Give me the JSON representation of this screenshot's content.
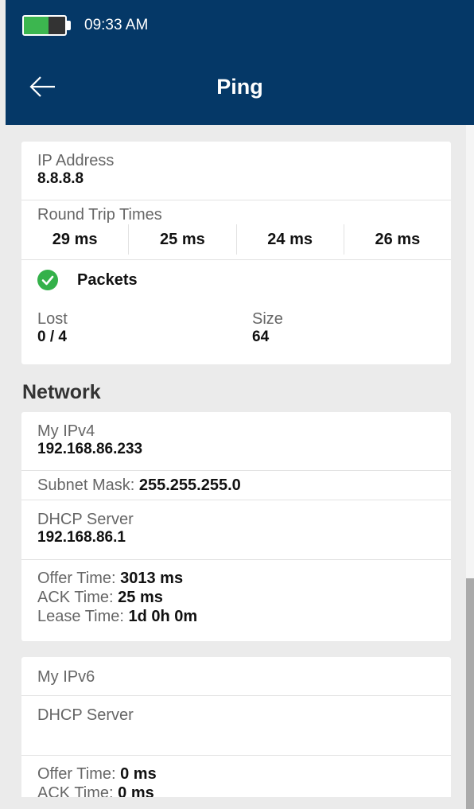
{
  "status_bar": {
    "time": "09:33 AM",
    "battery_level": 0.6,
    "battery_color": "#3cb64f"
  },
  "header": {
    "title": "Ping",
    "back_icon": "arrow-left-icon",
    "bg_color": "#053867"
  },
  "ping": {
    "ip_label": "IP Address",
    "ip_value": "8.8.8.8",
    "rtt_label": "Round Trip Times",
    "rtt": [
      "29 ms",
      "25 ms",
      "24 ms",
      "26 ms"
    ],
    "packets_label": "Packets",
    "status_icon": "check-circle-icon",
    "lost_label": "Lost",
    "lost_value": "0 / 4",
    "size_label": "Size",
    "size_value": "64"
  },
  "network": {
    "section_title": "Network",
    "ipv4": {
      "label": "My IPv4",
      "value": "192.168.86.233",
      "subnet_label": "Subnet Mask: ",
      "subnet_value": "255.255.255.0",
      "dhcp_label": "DHCP Server",
      "dhcp_value": "192.168.86.1",
      "offer_label": "Offer Time: ",
      "offer_value": "3013 ms",
      "ack_label": "ACK Time: ",
      "ack_value": "25 ms",
      "lease_label": "Lease Time: ",
      "lease_value": "1d 0h 0m"
    },
    "ipv6": {
      "label": "My IPv6",
      "dhcp_label": "DHCP Server",
      "offer_label": "Offer Time: ",
      "offer_value": "0 ms",
      "ack_label": "ACK Time: ",
      "ack_value": "0 ms"
    }
  }
}
